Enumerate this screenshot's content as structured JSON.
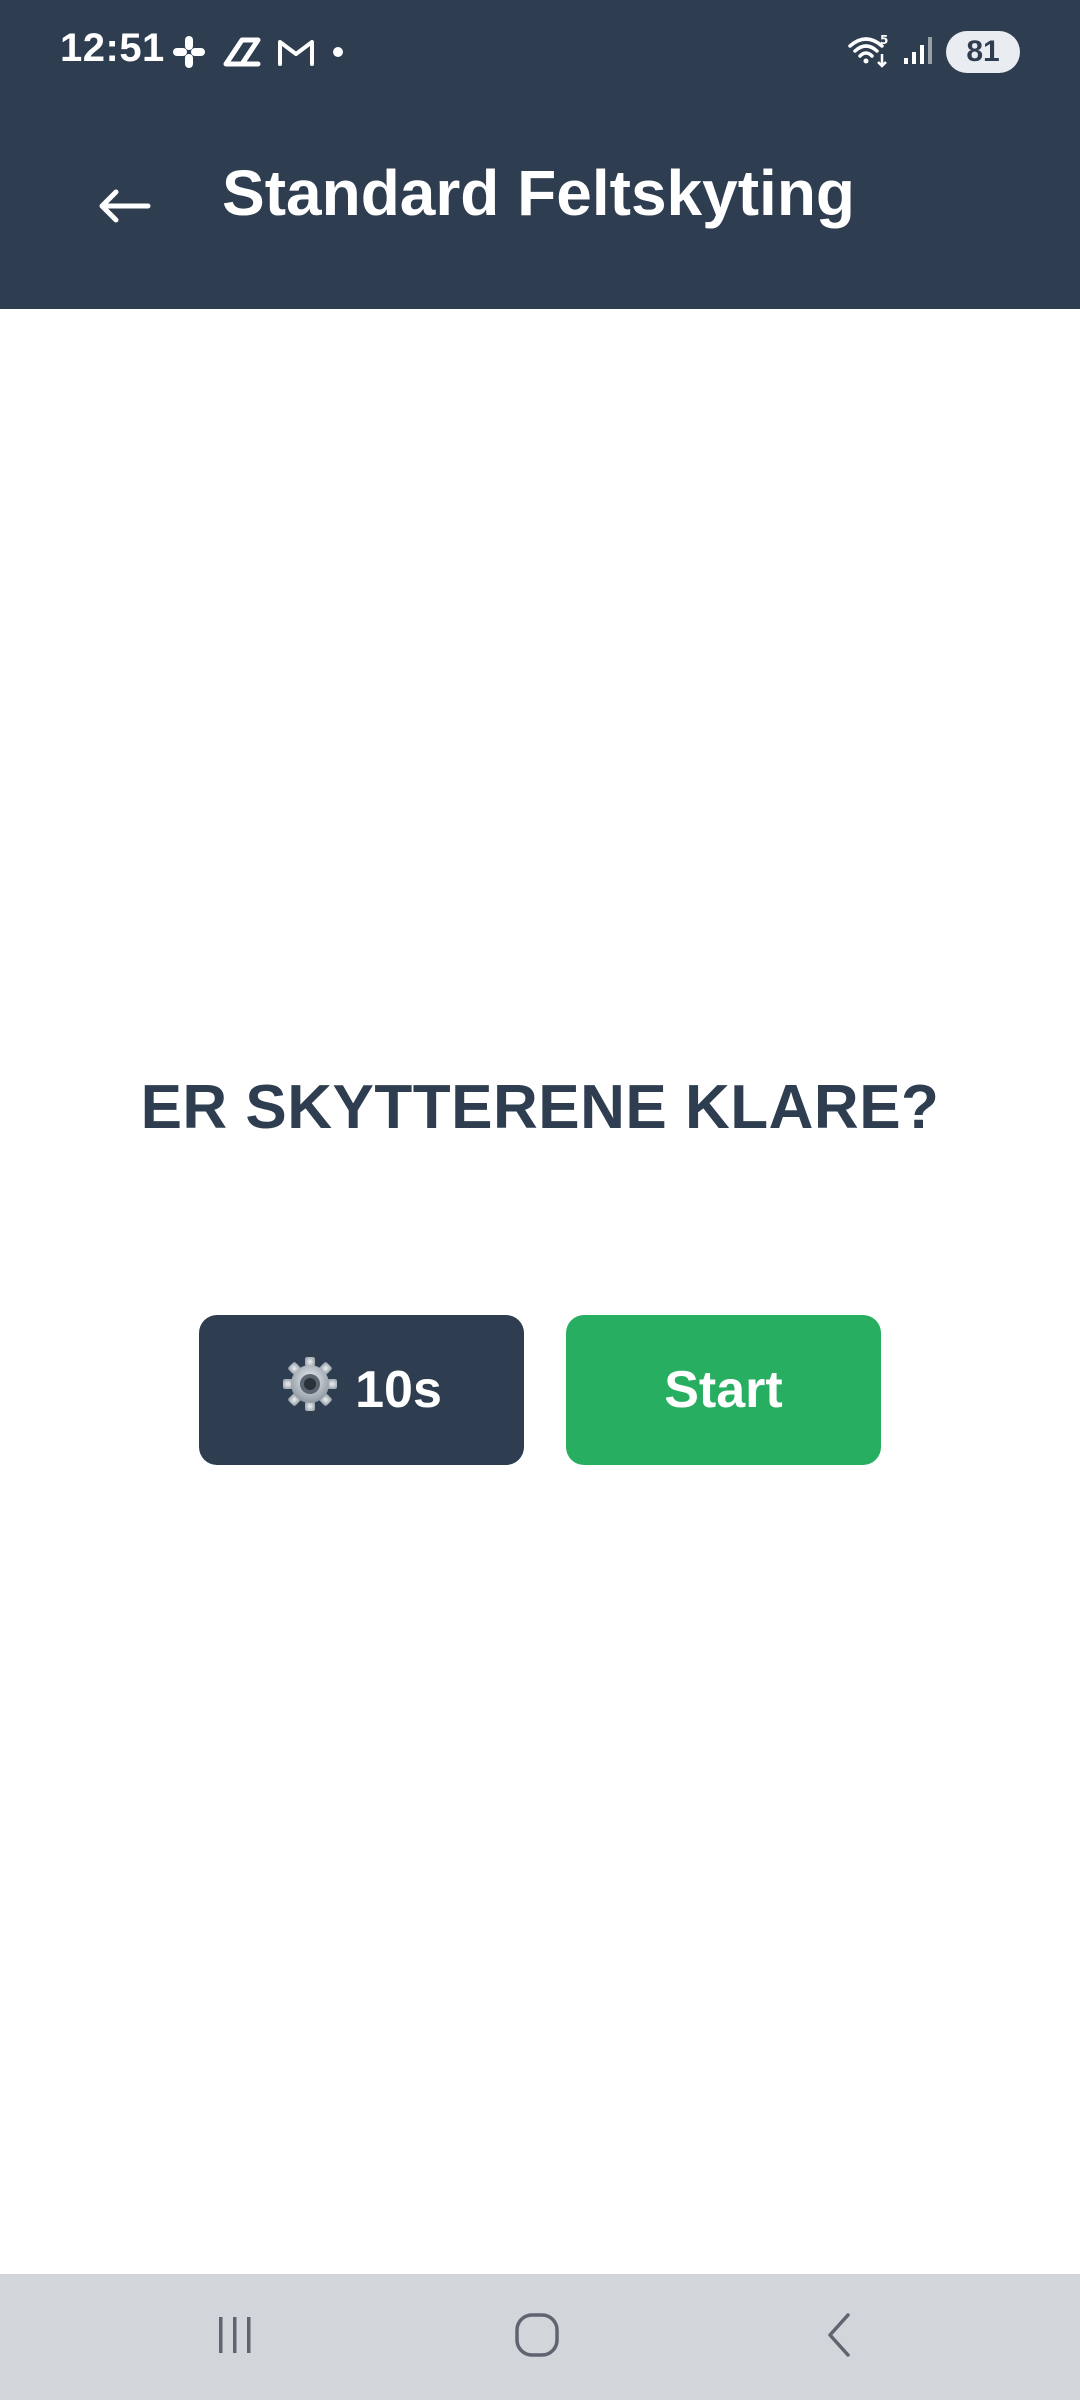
{
  "status_bar": {
    "time": "12:51",
    "notification_icons": [
      "slack-icon",
      "zapier-like-icon",
      "gmail-icon",
      "dot-icon"
    ],
    "wifi_label": "5",
    "battery": "81"
  },
  "app_bar": {
    "back_icon": "arrow-left-icon",
    "title": "Standard Feltskyting"
  },
  "main": {
    "prompt": "ER SKYTTERENE KLARE?",
    "settings_button": {
      "icon": "gear-icon",
      "label": "10s"
    },
    "start_button": {
      "label": "Start"
    }
  },
  "nav_bar": {
    "recent_icon": "recent-apps-icon",
    "home_icon": "home-icon",
    "back_icon": "nav-back-icon"
  },
  "colors": {
    "header_bg": "#2e3e50",
    "primary_dark": "#2e3e50",
    "start_green": "#27ae60",
    "nav_bg": "#d2d5da"
  }
}
